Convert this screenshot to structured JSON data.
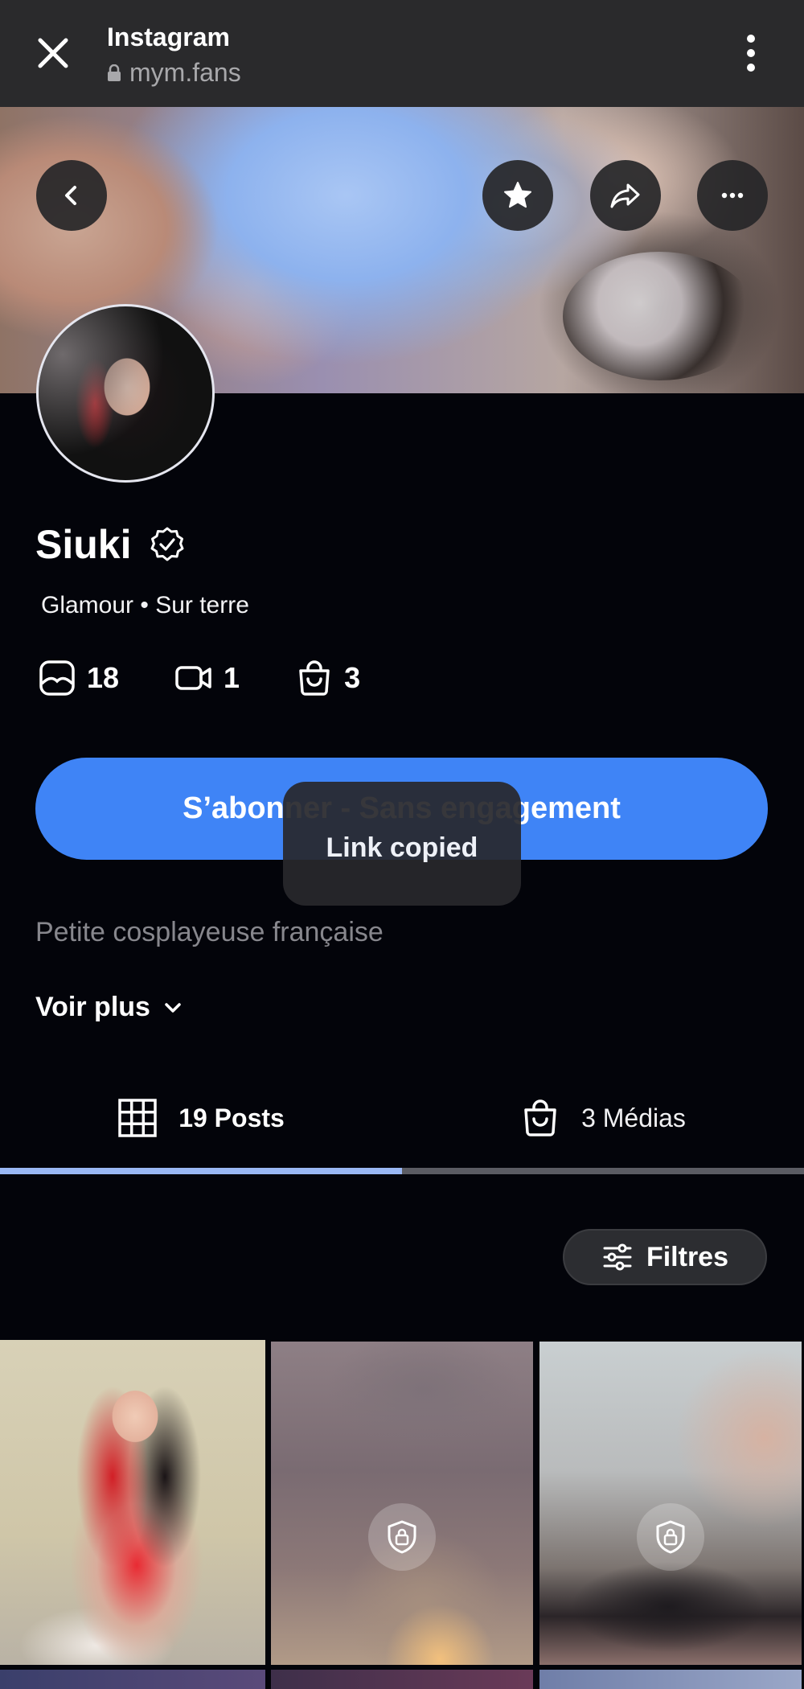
{
  "browser": {
    "app_title": "Instagram",
    "url": "mym.fans"
  },
  "profile": {
    "name": "Siuki",
    "subtitle": "Glamour • Sur terre",
    "stats": {
      "posts_count": "18",
      "videos_count": "1",
      "purchases_count": "3"
    },
    "subscribe_label": "S’abonner - Sans engagement",
    "bio": "Petite cosplayeuse française",
    "see_more_label": "Voir plus"
  },
  "toast": {
    "message": "Link copied"
  },
  "tabs": {
    "posts_label": "19 Posts",
    "media_label": "3 Médias",
    "active": "posts"
  },
  "filters": {
    "label": "Filtres"
  },
  "colors": {
    "accent": "#3f84f6",
    "tab_indicator": "#9ab8f4",
    "background": "#03040a",
    "topbar": "#2a2a2c"
  },
  "icons": {
    "close": "close-icon",
    "lock_url": "lock-icon",
    "menu": "kebab-menu-icon",
    "back": "chevron-left-icon",
    "favorite": "star-icon",
    "share": "share-icon",
    "more": "ellipsis-icon",
    "verified": "verified-badge-icon",
    "photos": "photo-icon",
    "videos": "video-camera-icon",
    "shop": "shopping-bag-icon",
    "grid": "grid-icon",
    "filters": "sliders-icon",
    "locked_post": "locked-content-icon"
  }
}
